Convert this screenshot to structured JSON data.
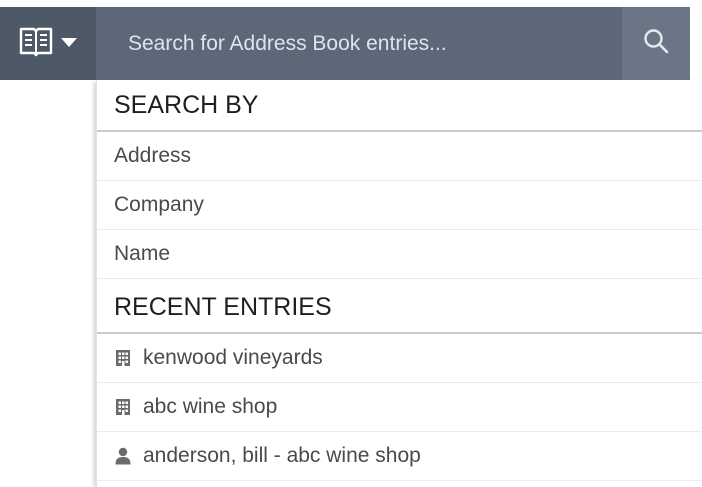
{
  "search": {
    "placeholder": "Search for Address Book entries..."
  },
  "search_by": {
    "title": "SEARCH BY",
    "items": [
      {
        "label": "Address"
      },
      {
        "label": "Company"
      },
      {
        "label": "Name"
      }
    ]
  },
  "recent": {
    "title": "RECENT ENTRIES",
    "items": [
      {
        "label": "kenwood vineyards",
        "icon": "building-icon"
      },
      {
        "label": "abc wine shop",
        "icon": "building-icon"
      },
      {
        "label": "anderson, bill - abc wine shop",
        "icon": "person-icon"
      }
    ]
  },
  "colors": {
    "header_dark": "#4d5966",
    "search_bg": "#5c6878",
    "search_btn_bg": "#6a7686"
  }
}
